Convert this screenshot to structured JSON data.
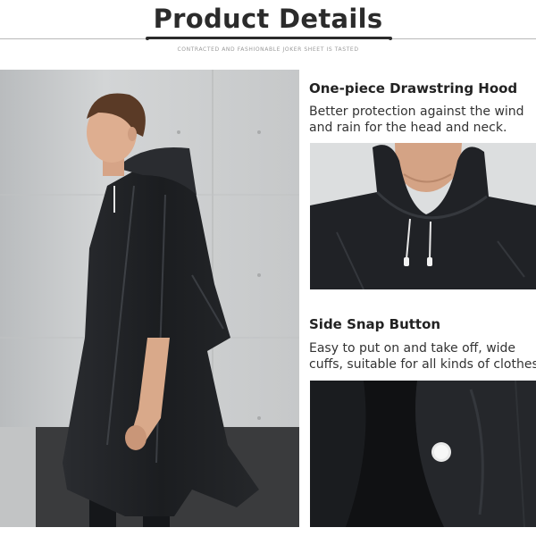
{
  "header": {
    "title": "Product Details",
    "tagline": "CONTRACTED AND FASHIONABLE JOKER SHEET IS TASTED"
  },
  "features": [
    {
      "title": "One-piece Drawstring Hood",
      "desc_line1": "Better protection against the wind",
      "desc_line2": "and rain for the head and neck."
    },
    {
      "title": "Side Snap Button",
      "desc_line1": "Easy to put on and take off, wide",
      "desc_line2": "cuffs, suitable for all kinds of clothes"
    }
  ],
  "colors": {
    "poncho": "#1d1f22",
    "wall": "#c9cbcc",
    "title": "#2b2b2b"
  }
}
